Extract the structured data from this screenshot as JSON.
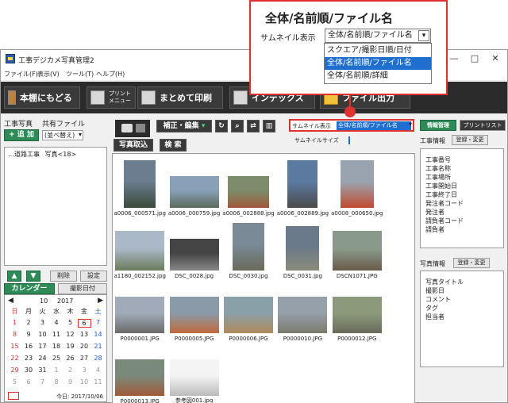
{
  "window": {
    "title": "工事デジカメ写真管理2",
    "controls": [
      "—",
      "□",
      "✕"
    ]
  },
  "menu": [
    "ファイル(F)",
    "表示(V)",
    "ツール(T)",
    "ヘルプ(H)"
  ],
  "toolbar": {
    "back": "本棚にもどる",
    "print_menu_line1": "プリント",
    "print_menu_line2": "メニュー",
    "batch_print": "まとめて印刷",
    "index": "インデックス",
    "file_output": "ファイル出力"
  },
  "left": {
    "tab_photos": "工事写真",
    "tab_shared": "共有ファイル",
    "add_button": "追 加",
    "sort_select": "(並べ替え)",
    "tree_item": "道路工事",
    "tree_count": "写真<18>",
    "delete_button": "削除",
    "settings_button": "設定",
    "calendar_button": "カレンダー",
    "shoot_date_button": "撮影日付",
    "calendar": {
      "month": "10",
      "year": "2017",
      "weekdays": [
        "日",
        "月",
        "火",
        "水",
        "木",
        "金",
        "土"
      ],
      "weeks": [
        [
          "1",
          "2",
          "3",
          "4",
          "5",
          "6",
          "7"
        ],
        [
          "8",
          "9",
          "10",
          "11",
          "12",
          "13",
          "14"
        ],
        [
          "15",
          "16",
          "17",
          "18",
          "19",
          "20",
          "21"
        ],
        [
          "22",
          "23",
          "24",
          "25",
          "26",
          "27",
          "28"
        ],
        [
          "29",
          "30",
          "31",
          "1",
          "2",
          "3",
          "4"
        ],
        [
          "5",
          "6",
          "7",
          "8",
          "9",
          "10",
          "11"
        ]
      ],
      "selected_day": "6",
      "today_label": "今日: 2017/10/06"
    }
  },
  "main": {
    "photo_import": "写真取込",
    "edit_menu": "補正・編集",
    "search": "検 索",
    "thumbnail_label": "サムネイル表示",
    "thumbnail_value": "全体/名前順/ファイル名",
    "thumbnail_size_label": "サムネイルサイズ",
    "thumbnails": [
      "a0006_000571.jpg",
      "a0006_000759.jpg",
      "a0006_002888.jpg",
      "a0006_002889.jpg",
      "a0008_000650.jpg",
      "a1180_002152.jpg",
      "DSC_0028.jpg",
      "DSC_0030.jpg",
      "DSC_0031.jpg",
      "DSCN1071.JPG",
      "P0000001.JPG",
      "P0000005.JPG",
      "P0000006.JPG",
      "P0000010.JPG",
      "P0000012.JPG",
      "P0000013.JPG",
      "参考図001.jpg"
    ]
  },
  "right": {
    "info_tab": "情報管理",
    "print_list_tab": "プリントリスト",
    "construction_info_label": "工事情報",
    "register_change": "登録・変更",
    "construction_fields": [
      "工事番号",
      "工事名称",
      "工事場所",
      "工事開始日",
      "工事終了日",
      "発注者コード",
      "発注者",
      "請負者コード",
      "請負者"
    ],
    "photo_info_label": "写真情報",
    "photo_fields": [
      "写真タイトル",
      "撮影日",
      "コメント",
      "タグ",
      "担当者"
    ]
  },
  "callout": {
    "heading": "全体/名前順/ファイル名",
    "label": "サムネイル表示",
    "current": "全体/名前順/ファイル名",
    "options": [
      "スクエア/撮影日順/日付",
      "全体/名前順/ファイル名",
      "全体/名前順/詳細"
    ],
    "selected_index": 1
  }
}
